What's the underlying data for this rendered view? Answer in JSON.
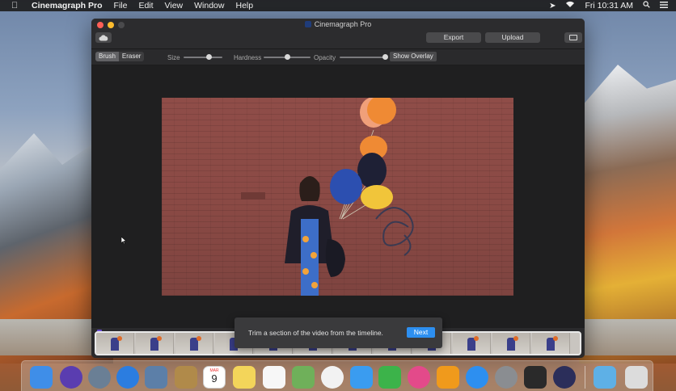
{
  "menubar": {
    "app_name": "Cinemagraph Pro",
    "items": [
      "File",
      "Edit",
      "View",
      "Window",
      "Help"
    ],
    "clock": "Fri 10:31 AM"
  },
  "window": {
    "title": "Cinemagraph Pro",
    "export_label": "Export",
    "upload_label": "Upload"
  },
  "toolbar": {
    "brush_label": "Brush",
    "eraser_label": "Eraser",
    "size_label": "Size",
    "hardness_label": "Hardness",
    "opacity_label": "Opacity",
    "show_overlay_label": "Show Overlay",
    "size_value": 0.65,
    "hardness_value": 0.5,
    "opacity_value": 1.0
  },
  "tooltip": {
    "message": "Trim a section of the video from the timeline.",
    "next_label": "Next"
  },
  "dock": {
    "calendar_month": "MAR",
    "calendar_day": "9",
    "icons": [
      {
        "name": "finder-icon",
        "color": "#3f8ee8"
      },
      {
        "name": "siri-icon",
        "color": "#5a3db0"
      },
      {
        "name": "launchpad-icon",
        "color": "#6a7f95"
      },
      {
        "name": "safari-icon",
        "color": "#2b7de0"
      },
      {
        "name": "mail-icon",
        "color": "#5c7fa8"
      },
      {
        "name": "notefile-icon",
        "color": "#b08a4a"
      },
      {
        "name": "calendar-icon",
        "color": "#ffffff"
      },
      {
        "name": "notes-icon",
        "color": "#f3d55a"
      },
      {
        "name": "reminders-icon",
        "color": "#f7f7f7"
      },
      {
        "name": "maps-icon",
        "color": "#6fb05a"
      },
      {
        "name": "photos-icon",
        "color": "#f2f2f2"
      },
      {
        "name": "messages-icon",
        "color": "#3a9cf0"
      },
      {
        "name": "facetime-icon",
        "color": "#3cb34a"
      },
      {
        "name": "itunes-icon",
        "color": "#e34a8a"
      },
      {
        "name": "ibooks-icon",
        "color": "#f09a1c"
      },
      {
        "name": "app-store-icon",
        "color": "#2d8ff0"
      },
      {
        "name": "system-preferences-icon",
        "color": "#8a8d91"
      },
      {
        "name": "terminal-icon",
        "color": "#2a2a2a"
      },
      {
        "name": "cinemagraph-pro-icon",
        "color": "#2b2e5a"
      },
      {
        "name": "downloads-folder-icon",
        "color": "#5eb0e6"
      },
      {
        "name": "trash-icon",
        "color": "#dcdcdc"
      }
    ]
  }
}
